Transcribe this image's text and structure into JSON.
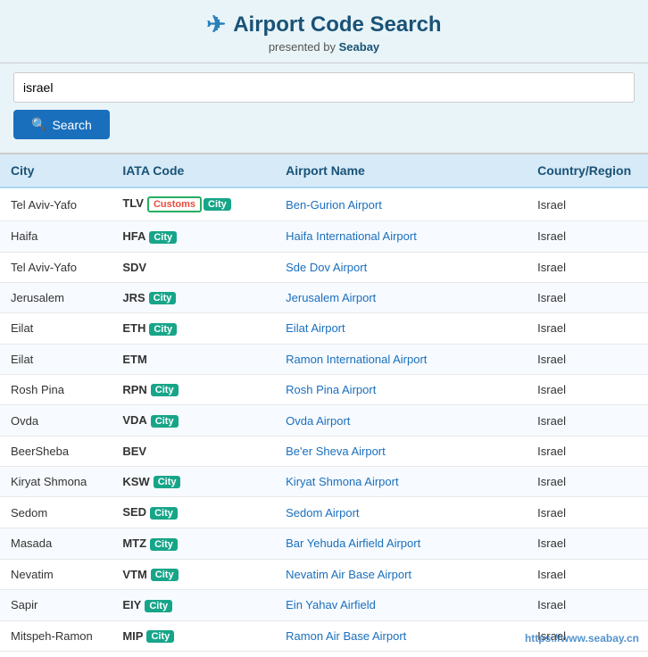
{
  "header": {
    "title": "Airport Code Search",
    "subtitle": "presented by",
    "brand": "Seabay",
    "icon": "✈"
  },
  "search": {
    "placeholder": "",
    "value": "israel",
    "button_label": "Search"
  },
  "table": {
    "columns": [
      "City",
      "IATA Code",
      "Airport Name",
      "Country/Region"
    ],
    "rows": [
      {
        "city": "Tel Aviv-Yafo",
        "iata": "TLV",
        "badges": [
          {
            "type": "customs",
            "label": "Customs"
          },
          {
            "type": "city",
            "label": "City"
          }
        ],
        "airport": "Ben-Gurion Airport",
        "country": "Israel"
      },
      {
        "city": "Haifa",
        "iata": "HFA",
        "badges": [
          {
            "type": "city",
            "label": "City"
          }
        ],
        "airport": "Haifa International Airport",
        "country": "Israel"
      },
      {
        "city": "Tel Aviv-Yafo",
        "iata": "SDV",
        "badges": [],
        "airport": "Sde Dov Airport",
        "country": "Israel"
      },
      {
        "city": "Jerusalem",
        "iata": "JRS",
        "badges": [
          {
            "type": "city",
            "label": "City"
          }
        ],
        "airport": "Jerusalem Airport",
        "country": "Israel"
      },
      {
        "city": "Eilat",
        "iata": "ETH",
        "badges": [
          {
            "type": "city",
            "label": "City"
          }
        ],
        "airport": "Eilat Airport",
        "country": "Israel"
      },
      {
        "city": "Eilat",
        "iata": "ETM",
        "badges": [],
        "airport": "Ramon International Airport",
        "country": "Israel"
      },
      {
        "city": "Rosh Pina",
        "iata": "RPN",
        "badges": [
          {
            "type": "city",
            "label": "City"
          }
        ],
        "airport": "Rosh Pina Airport",
        "country": "Israel"
      },
      {
        "city": "Ovda",
        "iata": "VDA",
        "badges": [
          {
            "type": "city",
            "label": "City"
          }
        ],
        "airport": "Ovda Airport",
        "country": "Israel"
      },
      {
        "city": "BeerSheba",
        "iata": "BEV",
        "badges": [],
        "airport": "Be'er Sheva Airport",
        "country": "Israel"
      },
      {
        "city": "Kiryat Shmona",
        "iata": "KSW",
        "badges": [
          {
            "type": "city",
            "label": "City"
          }
        ],
        "airport": "Kiryat Shmona Airport",
        "country": "Israel"
      },
      {
        "city": "Sedom",
        "iata": "SED",
        "badges": [
          {
            "type": "city",
            "label": "City"
          }
        ],
        "airport": "Sedom Airport",
        "country": "Israel"
      },
      {
        "city": "Masada",
        "iata": "MTZ",
        "badges": [
          {
            "type": "city",
            "label": "City"
          }
        ],
        "airport": "Bar Yehuda Airfield Airport",
        "country": "Israel"
      },
      {
        "city": "Nevatim",
        "iata": "VTM",
        "badges": [
          {
            "type": "city",
            "label": "City"
          }
        ],
        "airport": "Nevatim Air Base Airport",
        "country": "Israel"
      },
      {
        "city": "Sapir",
        "iata": "EIY",
        "badges": [
          {
            "type": "city",
            "label": "City"
          }
        ],
        "airport": "Ein Yahav Airfield",
        "country": "Israel"
      },
      {
        "city": "Mitspeh-Ramon",
        "iata": "MIP",
        "badges": [
          {
            "type": "city",
            "label": "City"
          }
        ],
        "airport": "Ramon Air Base Airport",
        "country": "Israel"
      }
    ]
  },
  "watermark": "https://www.seabay.cn"
}
